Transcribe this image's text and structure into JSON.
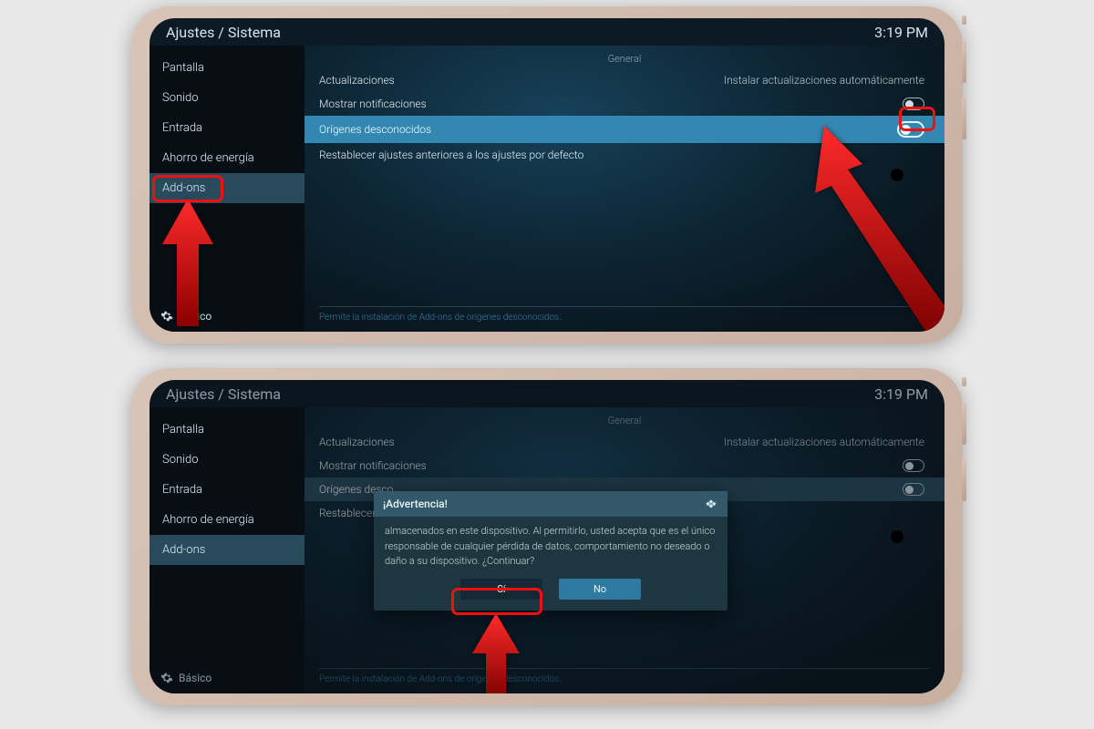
{
  "header": {
    "title": "Ajustes / Sistema",
    "time": "3:19 PM"
  },
  "sidebar": {
    "items": [
      "Pantalla",
      "Sonido",
      "Entrada",
      "Ahorro de energía",
      "Add-ons"
    ],
    "selected_label": "Add-ons",
    "footer": "Básico"
  },
  "main": {
    "section": "General",
    "rows": {
      "updates": {
        "label": "Actualizaciones",
        "value": "Instalar actualizaciones automáticamente"
      },
      "notifications": {
        "label": "Mostrar notificaciones"
      },
      "unknown_sources": {
        "label": "Orígenes desconocidos",
        "label_truncated": "Orígenes desco"
      },
      "reset_defaults": {
        "label": "Restablecer ajustes anteriores a los ajustes por defecto"
      }
    },
    "help": "Permite la instalación de Add-ons de orígenes desconocidos."
  },
  "dialog": {
    "title": "¡Advertencia!",
    "body": "almacenados en este dispositivo. Al permitirlo, usted acepta que es el único responsable de cualquier pérdida de datos, comportamiento no deseado o daño a su dispositivo. ¿Continuar?",
    "yes": "Sí",
    "no": "No"
  }
}
